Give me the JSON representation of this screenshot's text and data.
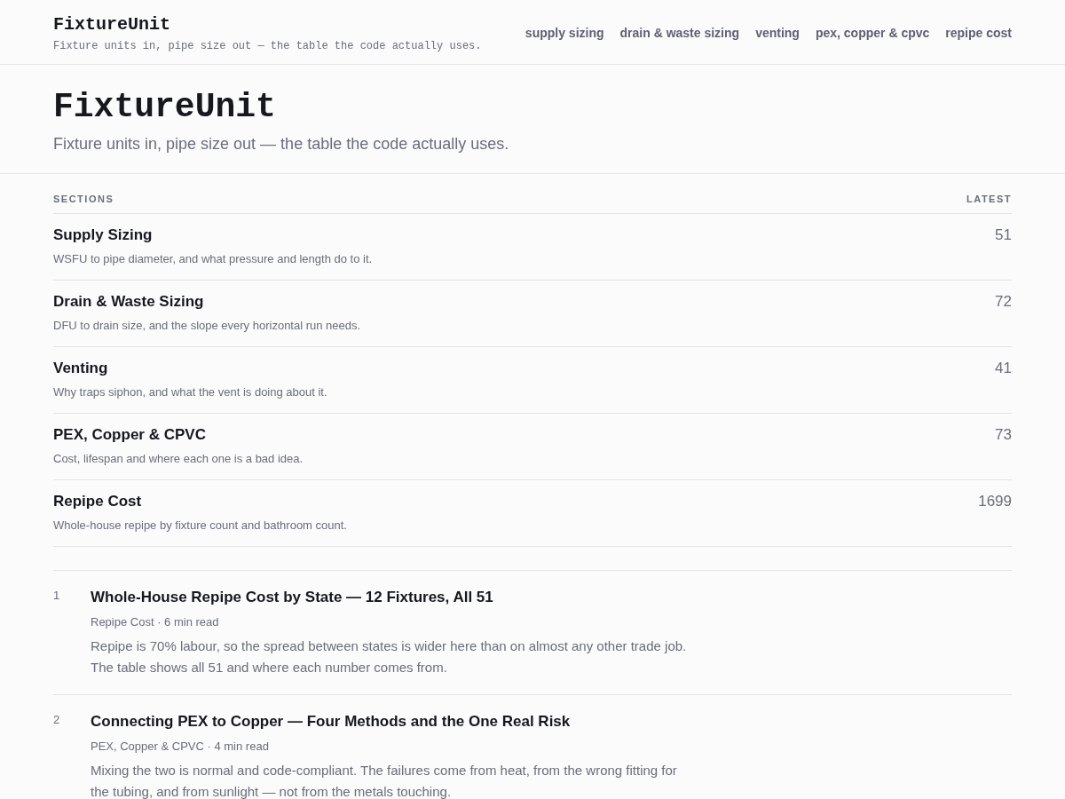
{
  "header": {
    "brand": "FixtureUnit",
    "tagline": "Fixture units in, pipe size out — the table the code actually uses.",
    "nav": [
      "supply sizing",
      "drain & waste sizing",
      "venting",
      "pex, copper & cpvc",
      "repipe cost"
    ]
  },
  "hero": {
    "title": "FixtureUnit",
    "subtitle": "Fixture units in, pipe size out — the table the code actually uses."
  },
  "sections": {
    "heading": "SECTIONS",
    "latest_heading": "LATEST",
    "items": [
      {
        "name": "Supply Sizing",
        "description": "WSFU to pipe diameter, and what pressure and length do to it.",
        "latest": "51"
      },
      {
        "name": "Drain & Waste Sizing",
        "description": "DFU to drain size, and the slope every horizontal run needs.",
        "latest": "72"
      },
      {
        "name": "Venting",
        "description": "Why traps siphon, and what the vent is doing about it.",
        "latest": "41"
      },
      {
        "name": "PEX, Copper & CPVC",
        "description": "Cost, lifespan and where each one is a bad idea.",
        "latest": "73"
      },
      {
        "name": "Repipe Cost",
        "description": "Whole-house repipe by fixture count and bathroom count.",
        "latest": "1699"
      }
    ]
  },
  "articles": [
    {
      "number": "1",
      "title": "Whole-House Repipe Cost by State — 12 Fixtures, All 51",
      "meta": "Repipe Cost · 6 min read",
      "summary": "Repipe is 70% labour, so the spread between states is wider here than on almost any other trade job. The table shows all 51 and where each number comes from."
    },
    {
      "number": "2",
      "title": "Connecting PEX to Copper — Four Methods and the One Real Risk",
      "meta": "PEX, Copper & CPVC · 4 min read",
      "summary": "Mixing the two is normal and code-compliant. The failures come from heat, from the wrong fitting for the tubing, and from sunlight — not from the metals touching."
    }
  ]
}
